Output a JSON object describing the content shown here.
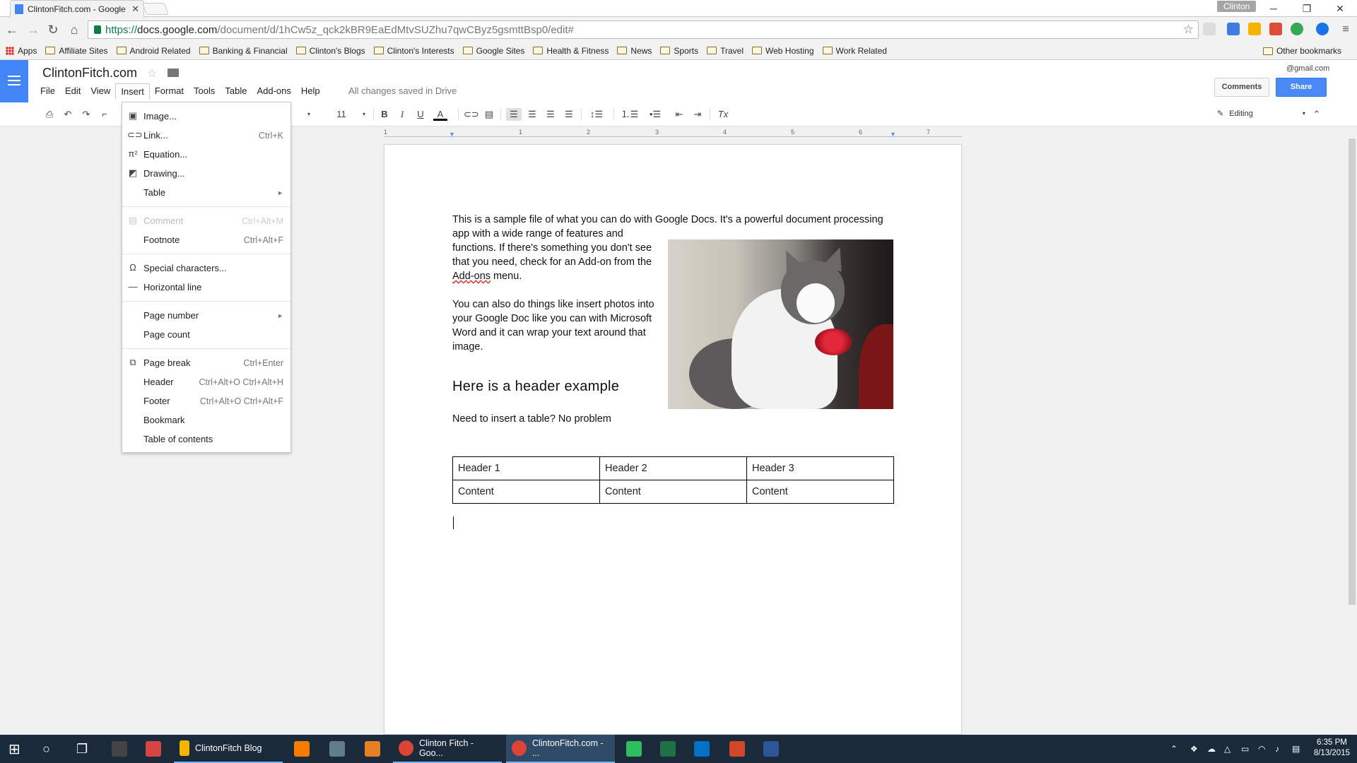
{
  "browser": {
    "tab_title": "ClintonFitch.com - Google",
    "tab_close": "✕",
    "profile": "Clinton",
    "url_https": "https://",
    "url_host": "docs.google.com",
    "url_path": "/document/d/1hCw5z_qck2kBR9EaEdMtvSUZhu7qwCByz5gsmttBsp0/edit#",
    "bookmarks": [
      "Apps",
      "Affiliate Sites",
      "Android Related",
      "Banking & Financial",
      "Clinton's Blogs",
      "Clinton's Interests",
      "Google Sites",
      "Health & Fitness",
      "News",
      "Sports",
      "Travel",
      "Web Hosting",
      "Work Related"
    ],
    "other_bookmarks": "Other bookmarks"
  },
  "docs": {
    "title": "ClintonFitch.com",
    "menus": [
      "File",
      "Edit",
      "View",
      "Insert",
      "Format",
      "Tools",
      "Table",
      "Add-ons",
      "Help"
    ],
    "saved_status": "All changes saved in Drive",
    "account": "@gmail.com",
    "comments_label": "Comments",
    "share_label": "Share",
    "font_size": "11",
    "editing_label": "Editing"
  },
  "ruler": [
    "1",
    "1",
    "2",
    "3",
    "4",
    "5",
    "6",
    "7"
  ],
  "document": {
    "p1": "This is a sample file of what you can do with Google Docs.  It's a powerful document processing",
    "p2a": "app with a wide range of features and functions.  If there's something you don't see that you need, check for an Add-on from the ",
    "p2_addons": "Add-ons",
    "p2b": " menu.",
    "p3": "You can also do things like insert photos into your Google Doc like you can with Microsoft Word and it can wrap your text around that image.",
    "header": "Here is a header example",
    "p4": "Need to insert a table?  No problem",
    "table": [
      [
        "Header 1",
        "Header 2",
        "Header 3"
      ],
      [
        "Content",
        "Content",
        "Content"
      ]
    ]
  },
  "insert_menu": {
    "image": "Image...",
    "link": "Link...",
    "link_sc": "Ctrl+K",
    "equation": "Equation...",
    "drawing": "Drawing...",
    "table": "Table",
    "comment": "Comment",
    "comment_sc": "Ctrl+Alt+M",
    "footnote": "Footnote",
    "footnote_sc": "Ctrl+Alt+F",
    "special_chars": "Special characters...",
    "hline": "Horizontal line",
    "page_number": "Page number",
    "page_count": "Page count",
    "page_break": "Page break",
    "page_break_sc": "Ctrl+Enter",
    "header": "Header",
    "header_sc": "Ctrl+Alt+O Ctrl+Alt+H",
    "footer": "Footer",
    "footer_sc": "Ctrl+Alt+O Ctrl+Alt+F",
    "bookmark": "Bookmark",
    "toc": "Table of contents"
  },
  "taskbar": {
    "items": [
      "ClintonFitch Blog",
      "Clinton Fitch - Goo...",
      "ClintonFitch.com - ..."
    ],
    "time": "6:35 PM",
    "date": "8/13/2015"
  },
  "colors": {
    "docs_blue": "#4285f4",
    "share_blue": "#4a8af4",
    "taskbar": "#1a2a3a"
  }
}
